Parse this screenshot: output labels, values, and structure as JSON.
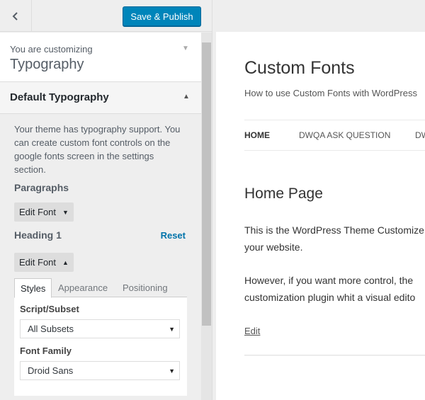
{
  "header": {
    "save_label": "Save & Publish"
  },
  "customizing": {
    "label": "You are customizing",
    "title": "Typography"
  },
  "section": {
    "title": "Default Typography",
    "intro": "Your theme has typography support. You can create custom font controls on the google fonts screen in the settings section."
  },
  "controls": {
    "paragraphs": {
      "title": "Paragraphs",
      "button": "Edit Font"
    },
    "heading1": {
      "title": "Heading 1",
      "reset": "Reset",
      "button": "Edit Font",
      "tabs": [
        "Styles",
        "Appearance",
        "Positioning"
      ],
      "fields": {
        "subset_label": "Script/Subset",
        "subset_value": "All Subsets",
        "family_label": "Font Family",
        "family_value": "Droid Sans"
      }
    }
  },
  "preview": {
    "site_title": "Custom Fonts",
    "tagline": "How to use Custom Fonts with WordPress",
    "nav": [
      "HOME",
      "DWQA ASK QUESTION",
      "DW"
    ],
    "page_title": "Home Page",
    "paragraph1": "This is the WordPress Theme Customize your website.",
    "paragraph1_lines": [
      "This is the WordPress Theme Customize",
      "your website."
    ],
    "paragraph2_lines": [
      "However, if you want more control, the",
      "customization plugin whit a visual edito"
    ],
    "edit_link": "Edit"
  },
  "colors": {
    "accent": "#0085ba",
    "link": "#0073aa"
  },
  "icons": {
    "back": "chevron-left-icon",
    "customizing_toggle": "triangle-down-icon",
    "section_toggle": "triangle-up-icon"
  }
}
